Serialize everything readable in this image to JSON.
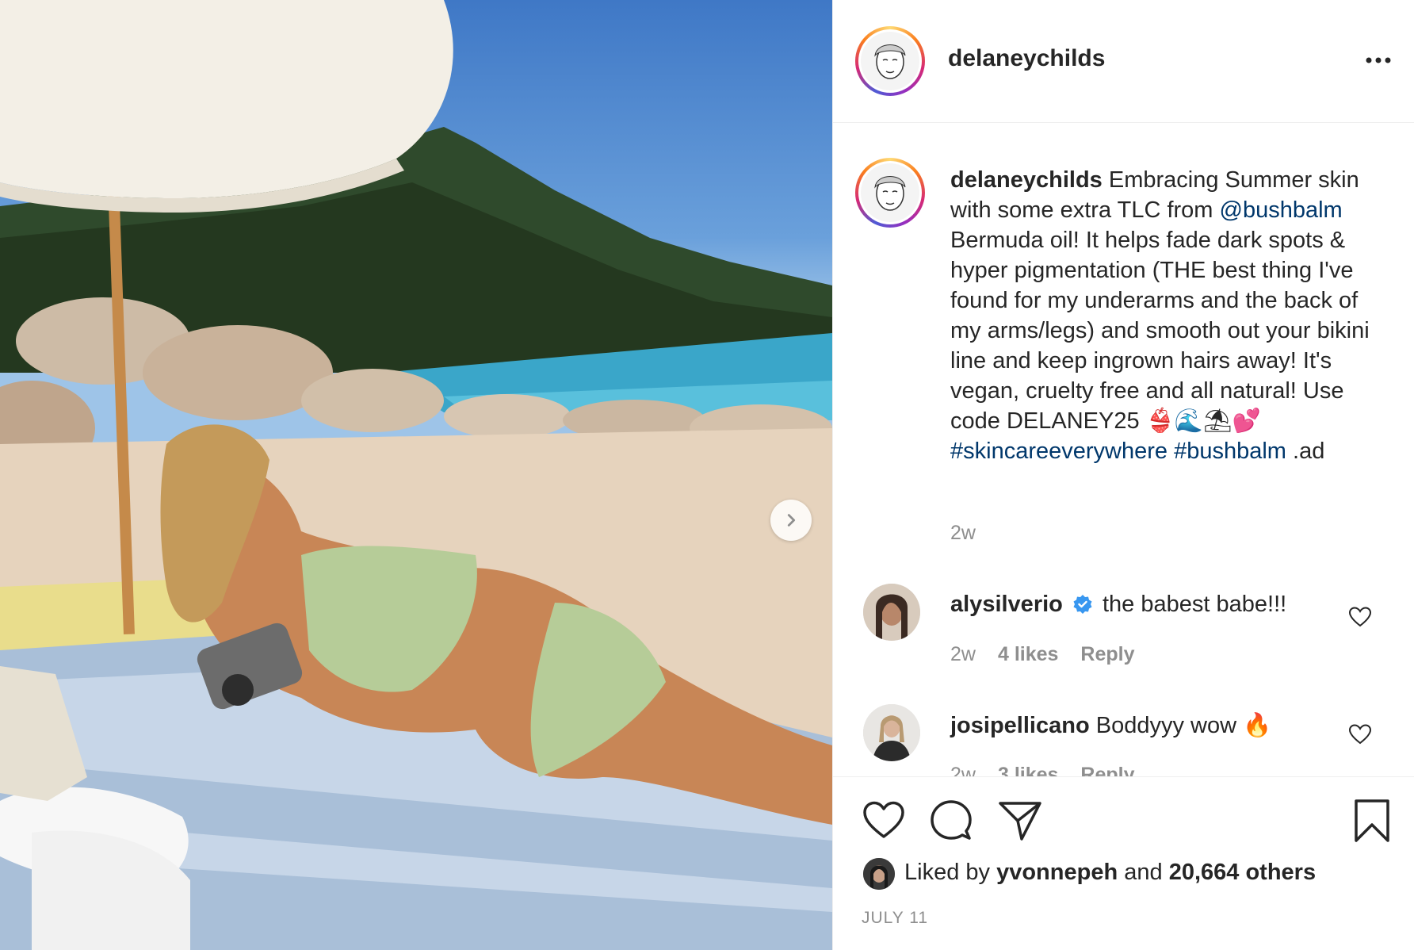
{
  "post": {
    "username": "delaneychilds",
    "more_icon": "more-horizontal-icon",
    "caption": {
      "username": "delaneychilds",
      "text_1": "Embracing Summer skin with some extra TLC from",
      "mention": "@bushbalm",
      "text_2": "Bermuda oil! It helps fade dark spots & hyper pigmentation (THE best thing I've found for my underarms and the back of my arms/legs) and smooth out your bikini line and keep ingrown hairs away! It's vegan, cruelty free and all natural! Use code DELANEY25 👙🌊⛱💕",
      "hashtag_1": "#skincareeverywhere",
      "hashtag_2": "#bushbalm",
      "text_3": ".ad",
      "time": "2w"
    },
    "comments": [
      {
        "username": "alysilverio",
        "verified": true,
        "text": "the babest babe!!!",
        "time": "2w",
        "likes": "4 likes",
        "reply": "Reply"
      },
      {
        "username": "josipellicano",
        "verified": false,
        "text": "Boddyyy wow 🔥",
        "time": "2w",
        "likes": "3 likes",
        "reply": "Reply"
      }
    ],
    "actions": {
      "like_icon": "heart-icon",
      "comment_icon": "comment-icon",
      "share_icon": "paper-plane-icon",
      "save_icon": "bookmark-icon"
    },
    "likes": {
      "prefix": "Liked by",
      "user": "yvonnepeh",
      "and": "and",
      "others": "20,664 others"
    },
    "date": "JULY 11"
  },
  "colors": {
    "link": "#00376b",
    "muted": "#8e8e8e",
    "text": "#262626",
    "verified": "#3897f0"
  }
}
